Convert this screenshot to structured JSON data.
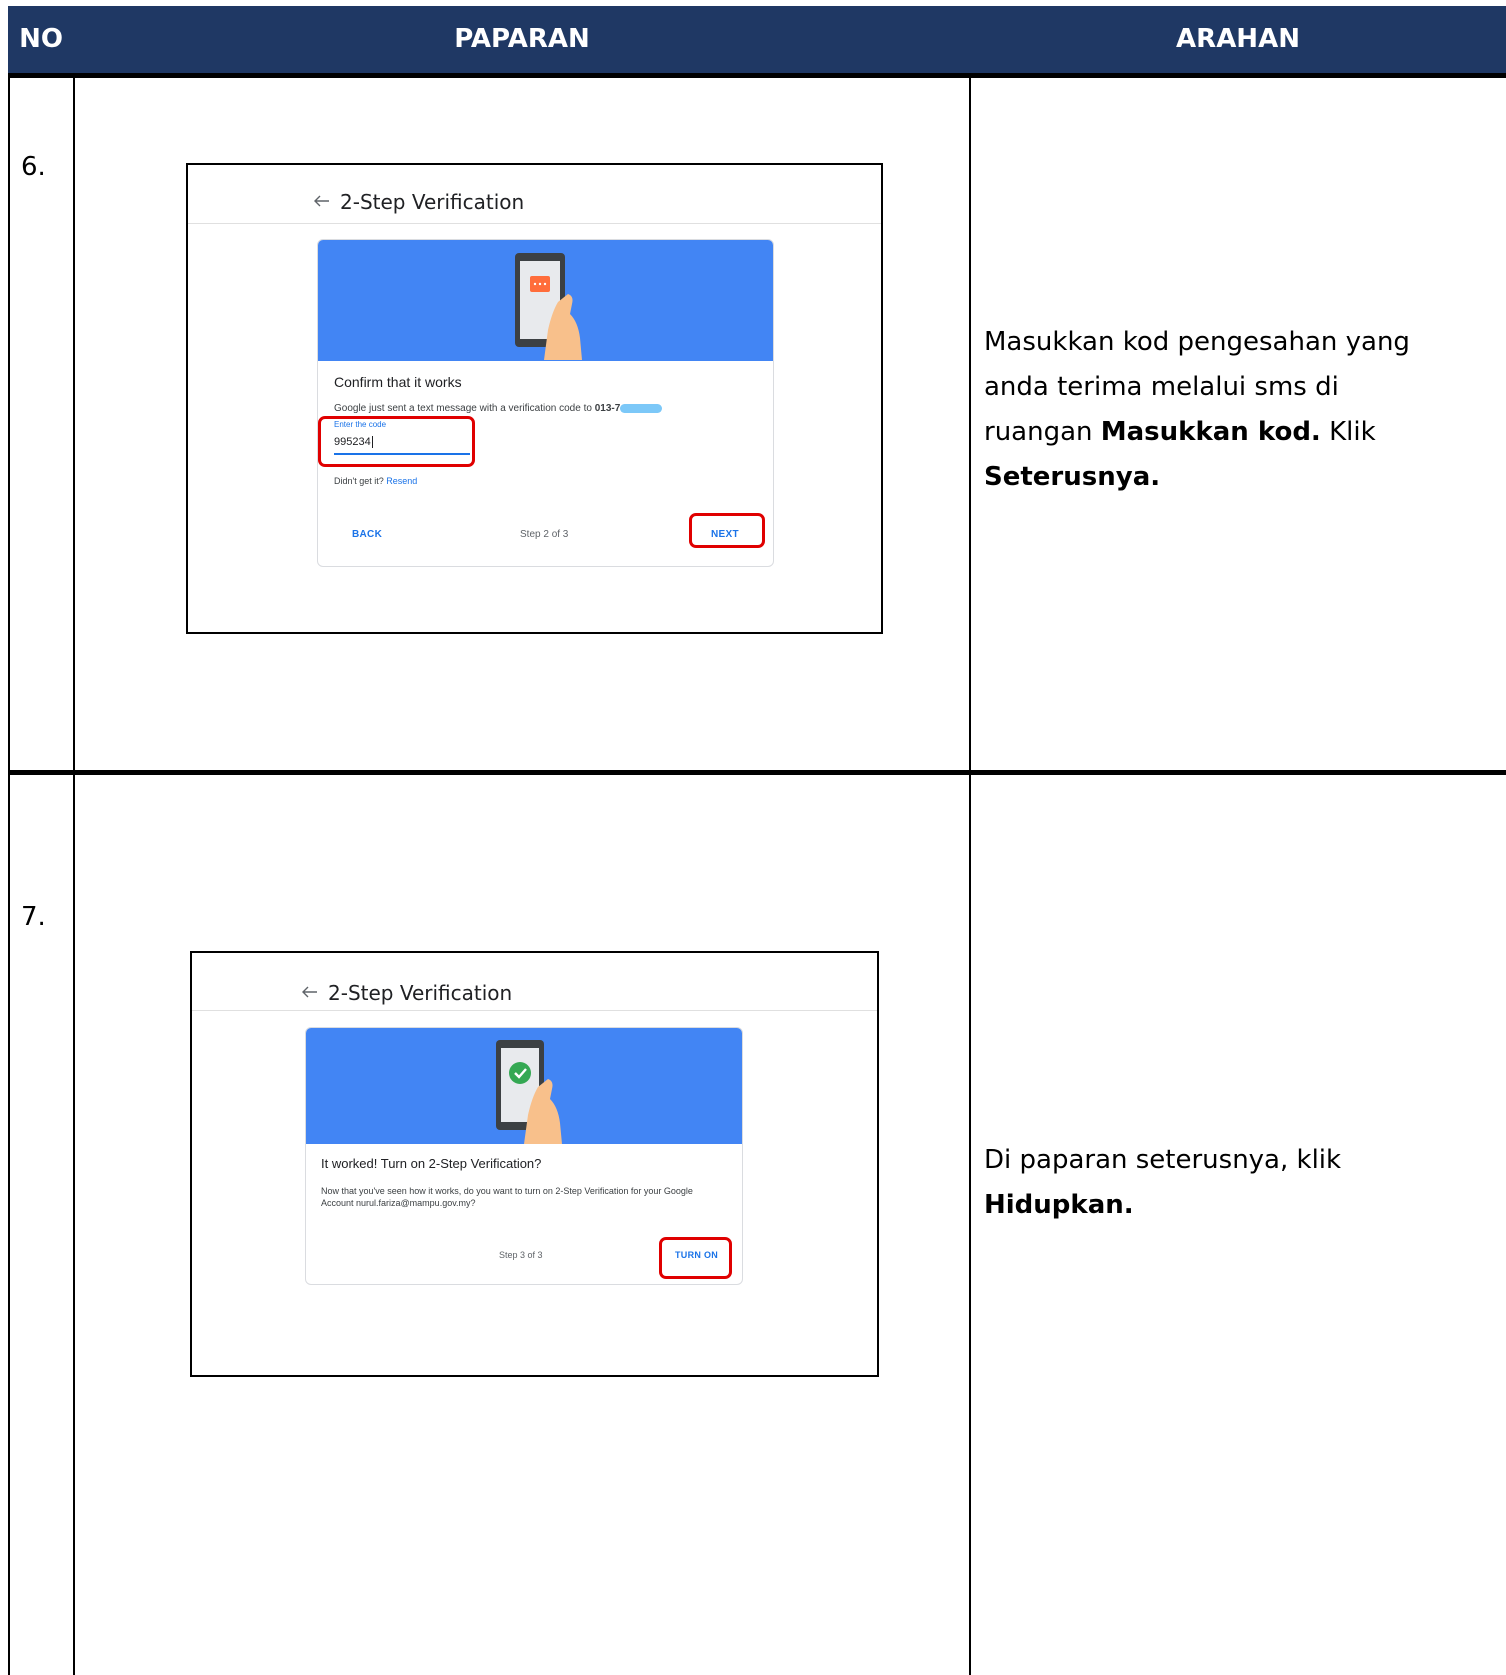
{
  "header": {
    "col_no": "NO",
    "col_display": "PAPARAN",
    "col_instruction": "ARAHAN"
  },
  "rows": [
    {
      "no": "6.",
      "screen": {
        "page_title": "2-Step Verification",
        "card_title": "Confirm that it works",
        "message": "Google just sent a text message with a verification code to",
        "phone": "013-7",
        "input_label": "Enter the code",
        "input_value": "995234",
        "resend_prompt": "Didn't get it?",
        "resend_link": "Resend",
        "back_button": "BACK",
        "step": "Step 2 of 3",
        "next_button": "NEXT"
      },
      "instruction": {
        "part1": "Masukkan kod pengesahan yang anda terima melalui sms di ruangan ",
        "bold1": "Masukkan kod.",
        "part2": " Klik ",
        "bold2": "Seterusnya."
      }
    },
    {
      "no": "7.",
      "screen": {
        "page_title": "2-Step Verification",
        "card_title": "It worked! Turn on 2-Step Verification?",
        "message_line1": "Now that you've seen how it works, do you want to turn on 2-Step Verification for your Google",
        "message_line2": "Account nurul.fariza@mampu.gov.my?",
        "step": "Step 3 of 3",
        "turn_on_button": "TURN ON"
      },
      "instruction": {
        "part1": "Di paparan seterusnya, klik ",
        "bold1": "Hidupkan."
      }
    }
  ],
  "colors": {
    "header_bg": "#1f3864",
    "banner_blue": "#4285f4",
    "highlight_red": "#e00000",
    "link_blue": "#1a73e8"
  },
  "icons": [
    "back-arrow-icon",
    "phone-message-icon",
    "phone-check-icon"
  ]
}
